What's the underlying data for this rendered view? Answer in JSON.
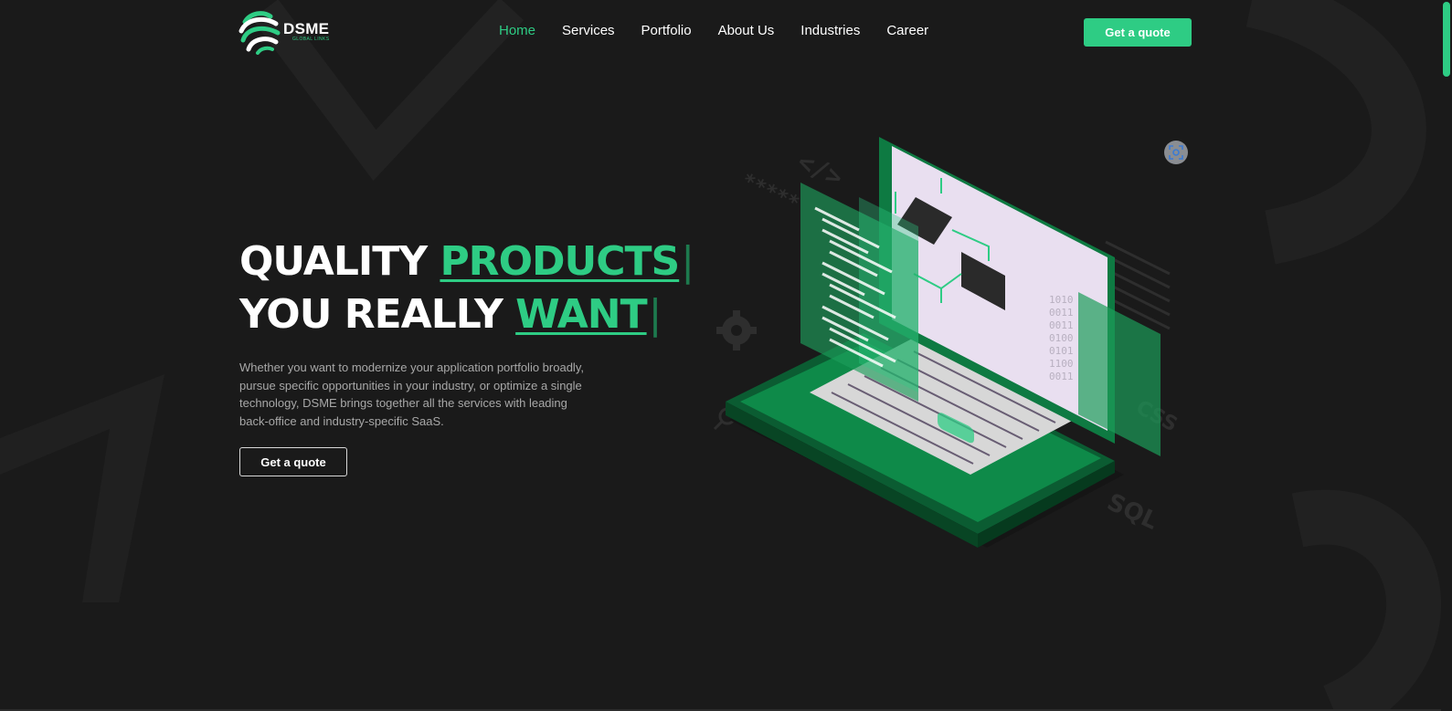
{
  "brand": {
    "name": "DSME",
    "tagline": "GLOBAL LINKS"
  },
  "nav": {
    "items": [
      {
        "label": "Home",
        "active": true
      },
      {
        "label": "Services",
        "active": false
      },
      {
        "label": "Portfolio",
        "active": false
      },
      {
        "label": "About Us",
        "active": false
      },
      {
        "label": "Industries",
        "active": false
      },
      {
        "label": "Career",
        "active": false
      }
    ],
    "cta_label": "Get a quote"
  },
  "hero": {
    "line1_plain": "QUALITY ",
    "line1_accent": "PRODUCTS",
    "line2_plain": "YOU REALLY ",
    "line2_accent": "WANT",
    "caret": "|",
    "description": "Whether you want to modernize your application portfolio broadly, pursue specific opportunities in your industry, or optimize a single technology, DSME brings together all the services with leading back-office and industry-specific SaaS.",
    "cta_label": "Get a quote"
  },
  "illustration": {
    "code_tag": "</>",
    "asterisks": "*****",
    "binary_lines": [
      "1010",
      "0011",
      "0011",
      "0100",
      "0101",
      "1100",
      "0011"
    ],
    "sql_label": "SQL",
    "css_label": "CSS"
  },
  "colors": {
    "accent": "#2ecc84",
    "background": "#1a1a1a",
    "text": "#ffffff",
    "muted": "#a8a8a8"
  },
  "icons": [
    "logo-mark",
    "expand-icon",
    "gear-icon",
    "search-icon"
  ]
}
